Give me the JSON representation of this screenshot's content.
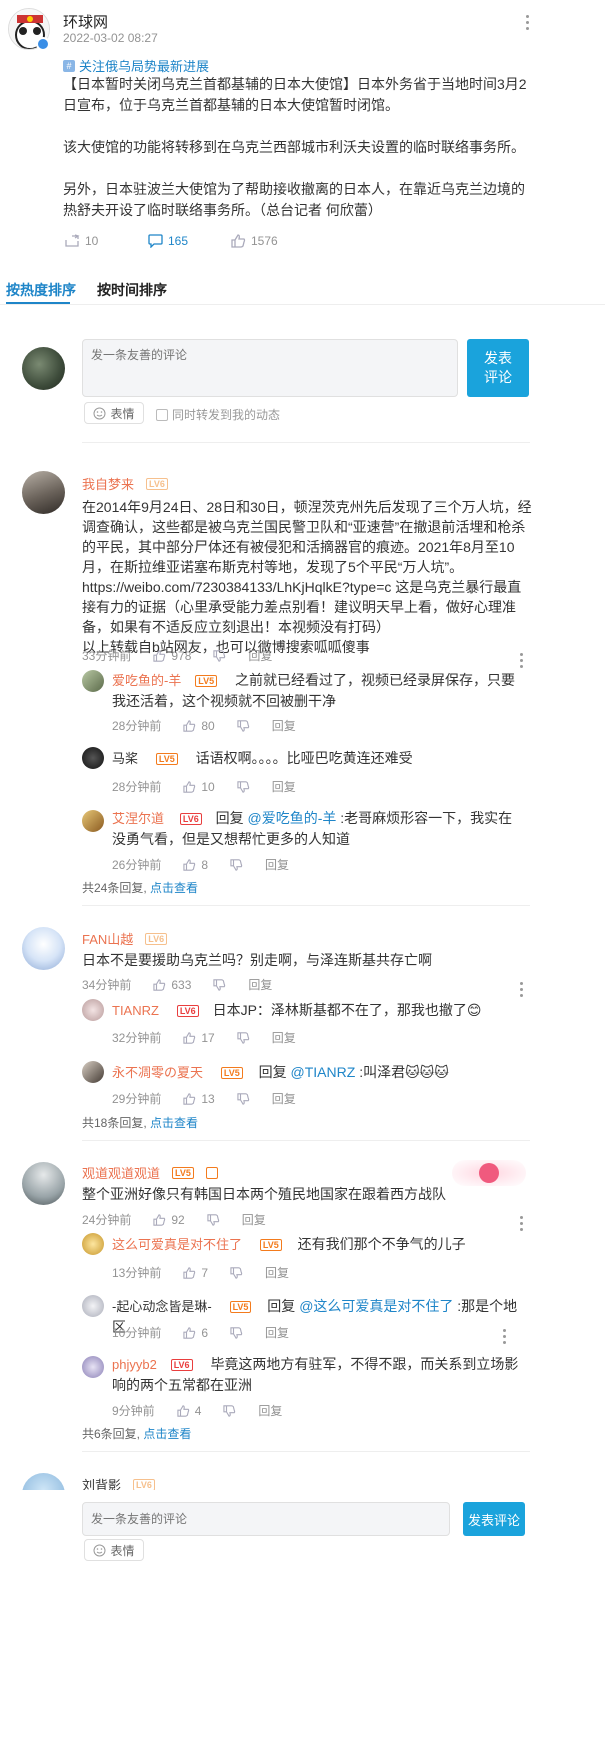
{
  "post": {
    "author": "环球网",
    "time": "2022-03-02 08:27",
    "topic": "关注俄乌局势最新进展",
    "paragraphs": [
      "【日本暂时关闭乌克兰首都基辅的日本大使馆】日本外务省于当地时间3月2日宣布，位于乌克兰首都基辅的日本大使馆暂时闭馆。",
      "该大使馆的功能将转移到在乌克兰西部城市利沃夫设置的临时联络事务所。",
      "另外，日本驻波兰大使馆为了帮助接收撤离的日本人，在靠近乌克兰边境的热舒夫开设了临时联络事务所。（总台记者  何欣蕾）"
    ],
    "repost_count": "10",
    "comment_count": "165",
    "like_count": "1576"
  },
  "tabs": {
    "hot": "按热度排序",
    "time": "按时间排序"
  },
  "composer": {
    "placeholder": "发一条友善的评论",
    "submit": "发表\n评论",
    "emoji_label": "表情",
    "repost_label": "同时转发到我的动态"
  },
  "bottom_bar": {
    "placeholder": "发一条友善的评论",
    "submit": "发表评论",
    "emoji_label": "表情"
  },
  "comments": [
    {
      "user": "我自梦来",
      "level": "LV6",
      "text": "在2014年9月24日、28日和30日，顿涅茨克州先后发现了三个万人坑，经调查确认，这些都是被乌克兰国民警卫队和“亚速营”在撤退前活埋和枪杀的平民，其中部分尸体还有被侵犯和活摘器官的痕迹。2021年8月至10月，在斯拉维亚诺塞布斯克村等地，发现了5个平民“万人坑”。\nhttps://weibo.com/7230384133/LhKjHqlkE?type=c 这是乌克兰暴行最直接有力的证据（心里承受能力差点别看！建议明天早上看，做好心理准备，如果有不适反应立刻退出！本视频没有打码）\n以上转载自b站网友，也可以微博搜索呱呱傻事",
      "time": "33分钟前",
      "likes": "978",
      "reply_label": "回复",
      "replies": [
        {
          "user": "爱吃鱼的-羊",
          "level": "LV5",
          "text": "之前就已经看过了，视频已经录屏保存，只要我还活着，这个视频就不回被删干净",
          "time": "28分钟前",
          "likes": "80",
          "reply_label": "回复"
        },
        {
          "user": "马桨",
          "level": "LV5",
          "text": "话语权啊。。。。比哑巴吃黄连还难受",
          "time": "28分钟前",
          "likes": "10",
          "reply_label": "回复"
        },
        {
          "user": "艾涅尔道",
          "level": "LV6",
          "reply_prefix": "回复",
          "mention": "@爱吃鱼的-羊",
          "text": ":老哥麻烦形容一下，我实在没勇气看，但是又想帮忙更多的人知道",
          "time": "26分钟前",
          "likes": "8",
          "reply_label": "回复"
        }
      ],
      "more_count": "共24条回复,",
      "more_link": "点击查看"
    },
    {
      "user": "FAN山越",
      "level": "LV6",
      "text": "日本不是要援助乌克兰吗？别走啊，与泽连斯基共存亡啊",
      "time": "34分钟前",
      "likes": "633",
      "reply_label": "回复",
      "replies": [
        {
          "user": "TIANRZ",
          "level": "LV6",
          "text": "日本JP：泽林斯基都不在了，那我也撤了😊",
          "time": "32分钟前",
          "likes": "17",
          "reply_label": "回复"
        },
        {
          "user": "永不凋零の夏天",
          "level": "LV5",
          "reply_prefix": "回复",
          "mention": "@TIANRZ",
          "text": ":叫泽君🐱🐱🐱",
          "time": "29分钟前",
          "likes": "13",
          "reply_label": "回复"
        }
      ],
      "more_count": "共18条回复,",
      "more_link": "点击查看"
    },
    {
      "user": "观道观道观道",
      "level": "LV5",
      "text": "整个亚洲好像只有韩国日本两个殖民地国家在跟着西方战队",
      "time": "24分钟前",
      "likes": "92",
      "reply_label": "回复",
      "replies": [
        {
          "user": "这么可爱真是对不住了",
          "level": "LV5",
          "text": "还有我们那个不争气的儿子",
          "time": "13分钟前",
          "likes": "7",
          "reply_label": "回复"
        },
        {
          "user": "-起心动念皆是琳-",
          "level": "LV5",
          "reply_prefix": "回复",
          "mention": "@这么可爱真是对不住了",
          "text": ":那是个地区",
          "time": "10分钟前",
          "likes": "6",
          "reply_label": "回复"
        },
        {
          "user": "phjyyb2",
          "level": "LV6",
          "text": "毕竟这两地方有驻军，不得不跟，而关系到立场影响的两个五常都在亚洲",
          "time": "9分钟前",
          "likes": "4",
          "reply_label": "回复"
        }
      ],
      "more_count": "共6条回复,",
      "more_link": "点击查看"
    },
    {
      "user": "刘背影",
      "level": "LV6"
    }
  ]
}
